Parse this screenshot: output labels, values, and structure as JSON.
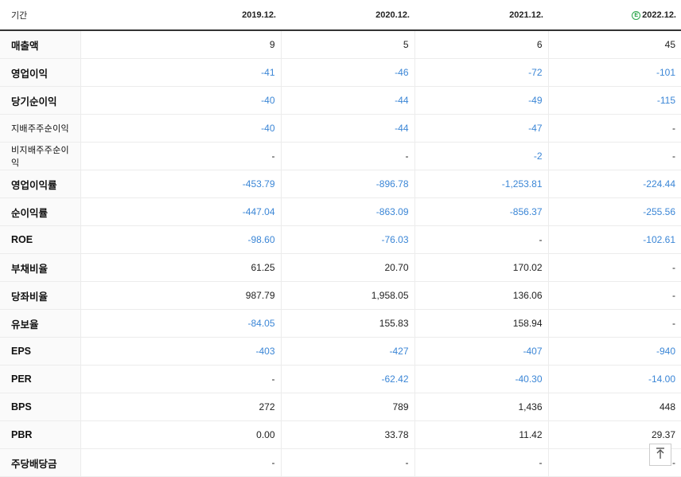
{
  "header": {
    "label": "기간",
    "periods": [
      "2019.12.",
      "2020.12.",
      "2021.12.",
      "2022.12."
    ],
    "estimate_icon": "E"
  },
  "colors": {
    "negative": "#3b86d6",
    "positive": "#222222",
    "estimate_accent": "#2aa54a"
  },
  "rows": [
    {
      "label": "매출액",
      "values": [
        "9",
        "5",
        "6",
        "45"
      ]
    },
    {
      "label": "영업이익",
      "values": [
        "-41",
        "-46",
        "-72",
        "-101"
      ]
    },
    {
      "label": "당기순이익",
      "values": [
        "-40",
        "-44",
        "-49",
        "-115"
      ]
    },
    {
      "label": "지배주주순이익",
      "values": [
        "-40",
        "-44",
        "-47",
        "-"
      ]
    },
    {
      "label": "비지배주주순이익",
      "values": [
        "-",
        "-",
        "-2",
        "-"
      ]
    },
    {
      "label": "영업이익률",
      "values": [
        "-453.79",
        "-896.78",
        "-1,253.81",
        "-224.44"
      ]
    },
    {
      "label": "순이익률",
      "values": [
        "-447.04",
        "-863.09",
        "-856.37",
        "-255.56"
      ]
    },
    {
      "label": "ROE",
      "values": [
        "-98.60",
        "-76.03",
        "-",
        "-102.61"
      ]
    },
    {
      "label": "부채비율",
      "values": [
        "61.25",
        "20.70",
        "170.02",
        "-"
      ]
    },
    {
      "label": "당좌비율",
      "values": [
        "987.79",
        "1,958.05",
        "136.06",
        "-"
      ]
    },
    {
      "label": "유보율",
      "values": [
        "-84.05",
        "155.83",
        "158.94",
        "-"
      ]
    },
    {
      "label": "EPS",
      "values": [
        "-403",
        "-427",
        "-407",
        "-940"
      ]
    },
    {
      "label": "PER",
      "values": [
        "-",
        "-62.42",
        "-40.30",
        "-14.00"
      ]
    },
    {
      "label": "BPS",
      "values": [
        "272",
        "789",
        "1,436",
        "448"
      ]
    },
    {
      "label": "PBR",
      "values": [
        "0.00",
        "33.78",
        "11.42",
        "29.37"
      ]
    },
    {
      "label": "주당배당금",
      "values": [
        "-",
        "-",
        "-",
        "-"
      ]
    }
  ],
  "scroll_top_icon": "arrow-up-to-top"
}
